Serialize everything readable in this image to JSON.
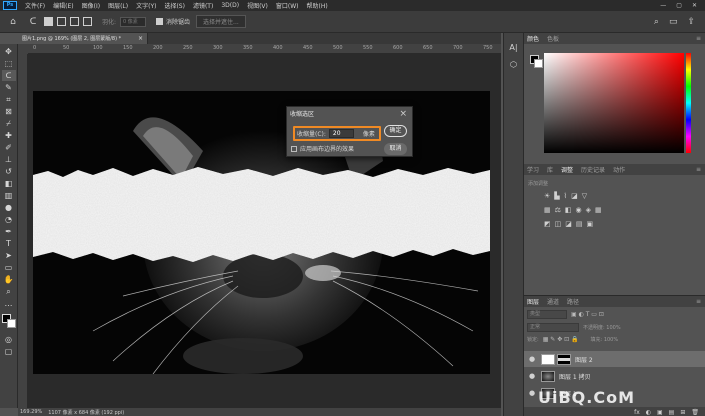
{
  "menubar": {
    "logo": "Ps",
    "items": [
      "文件(F)",
      "编辑(E)",
      "图像(I)",
      "图层(L)",
      "文字(Y)",
      "选择(S)",
      "滤镜(T)",
      "3D(D)",
      "视图(V)",
      "窗口(W)",
      "帮助(H)"
    ],
    "window_controls": [
      "—",
      "▢",
      "✕"
    ]
  },
  "options": {
    "feather_label": "羽化:",
    "feather_value": "0 像素",
    "antialias_label": "消除锯齿",
    "select_mask_label": "选择并遮住..."
  },
  "document": {
    "tab_title": "图片1.png @ 169% (图层 2, 图层蒙版/8) *",
    "ruler_ticks": [
      "0",
      "50",
      "100",
      "150",
      "200",
      "250",
      "300",
      "350",
      "400",
      "450",
      "500",
      "550",
      "600",
      "650",
      "700",
      "750"
    ]
  },
  "status": {
    "zoom": "169.29%",
    "info": "1107 像素 x 684 像素 (192 ppi)"
  },
  "dialog": {
    "title": "收缩选区",
    "amount_label": "收缩量(C):",
    "amount_value": "20",
    "unit": "像素",
    "checkbox_label": "应用画布边界的效果",
    "ok_label": "确定",
    "cancel_label": "取消"
  },
  "color_panel": {
    "tabs": [
      "颜色",
      "色板"
    ],
    "foreground": "#000000",
    "background": "#ffffff"
  },
  "adjust_panel": {
    "tabs": [
      "学习",
      "库",
      "调整",
      "历史记录",
      "动作"
    ],
    "add_label": "添加调整"
  },
  "layers_panel": {
    "tabs": [
      "图层",
      "通道",
      "路径"
    ],
    "kind_label": "类型",
    "blend_label": "正常",
    "opacity_label": "不透明度: 100%",
    "lock_label": "锁定:",
    "fill_label": "填充: 100%",
    "layers": [
      {
        "name": "图层 2",
        "selected": true
      },
      {
        "name": "图层 1 拷贝",
        "selected": false
      },
      {
        "name": "图层 1",
        "selected": false
      }
    ],
    "bottom_icons": [
      "fx",
      "◐",
      "▣",
      "▤",
      "⊞",
      "🗑"
    ]
  },
  "watermark": "UiBQ.CoM"
}
